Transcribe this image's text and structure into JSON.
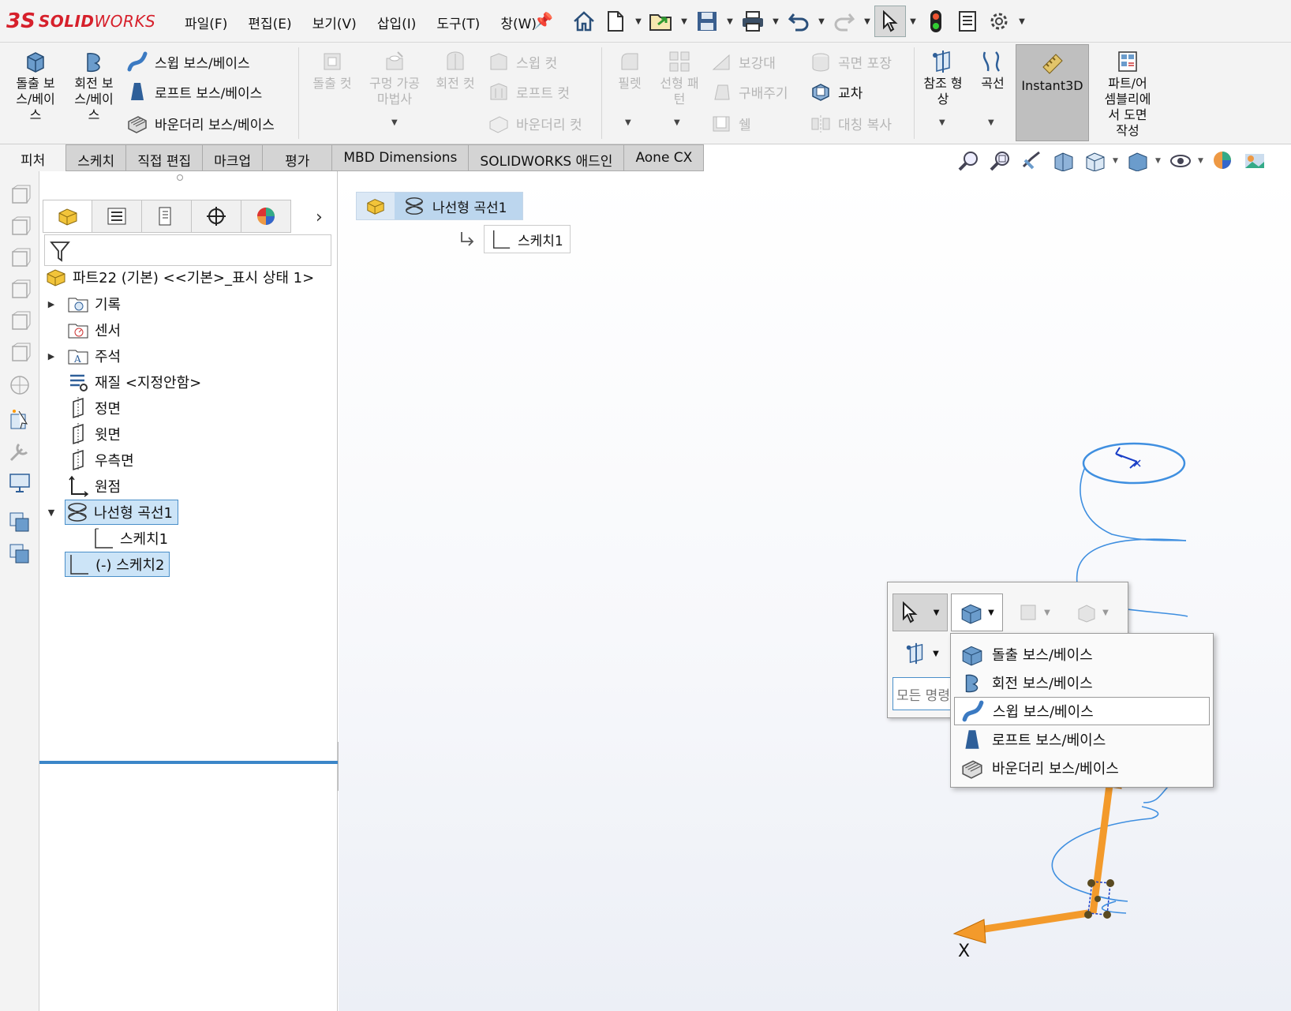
{
  "app": {
    "logo_mark": "3S",
    "logo_solid": "SOLID",
    "logo_works": "WORKS"
  },
  "menu": [
    "파일(F)",
    "편집(E)",
    "보기(V)",
    "삽입(I)",
    "도구(T)",
    "창(W)"
  ],
  "quick_access": [
    "home-icon",
    "new-document-icon",
    "open-icon",
    "save-icon",
    "print-icon",
    "undo-icon",
    "redo-icon",
    "select-icon",
    "rebuild-icon",
    "file-properties-icon",
    "options-icon"
  ],
  "ribbon": {
    "extrude_boss": "돌출 보\n스/베이\n스",
    "revolve_boss": "회전 보\n스/베이\n스",
    "sweep_boss": "스윕 보스/베이스",
    "loft_boss": "로프트 보스/베이스",
    "boundary_boss": "바운더리 보스/베이스",
    "extrude_cut": "돌출 컷",
    "hole_wizard": "구멍 가공\n마법사",
    "revolve_cut": "회전 컷",
    "sweep_cut": "스윕 컷",
    "loft_cut": "로프트 컷",
    "boundary_cut": "바운더리 컷",
    "fillet": "필렛",
    "linear_pattern": "선형 패\n턴",
    "rib": "보강대",
    "draft": "구배주기",
    "shell": "쉘",
    "wrap": "곡면 포장",
    "intersect": "교차",
    "mirror": "대칭 복사",
    "ref_geometry": "참조 형\n상",
    "curves": "곡선",
    "instant3d": "Instant3D",
    "make_drawing": "파트/어\n셈블리에\n서 도면\n작성"
  },
  "tabs": [
    "피처",
    "스케치",
    "직접 편집",
    "마크업",
    "평가",
    "MBD Dimensions",
    "SOLIDWORKS 애드인",
    "Aone CX"
  ],
  "tree": {
    "root": "파트22 (기본) <<기본>_표시 상태 1>",
    "items": [
      {
        "label": "기록",
        "expandable": true
      },
      {
        "label": "센서",
        "expandable": false
      },
      {
        "label": "주석",
        "expandable": true
      },
      {
        "label": "재질 <지정안함>",
        "expandable": false
      },
      {
        "label": "정면",
        "expandable": false
      },
      {
        "label": "윗면",
        "expandable": false
      },
      {
        "label": "우측면",
        "expandable": false
      },
      {
        "label": "원점",
        "expandable": false
      },
      {
        "label": "나선형 곡선1",
        "expandable": true,
        "expanded": true,
        "selected": true
      },
      {
        "label": "스케치1",
        "child": true
      },
      {
        "label": "(-) 스케치2",
        "selected": true
      }
    ]
  },
  "breadcrumb": {
    "feature": "나선형 곡선1",
    "sketch": "스케치1"
  },
  "context_toolbar": {
    "search_placeholder": "모든 명령",
    "menu_items": [
      "돌출 보스/베이스",
      "회전 보스/베이스",
      "스윕 보스/베이스",
      "로프트 보스/베이스",
      "바운더리 보스/베이스"
    ],
    "highlighted_index": 2
  },
  "triad": {
    "x_label": "X"
  },
  "colors": {
    "brand_red": "#d6202b",
    "highlight_blue": "#cce4f7",
    "helix_blue": "#3f8fe0",
    "triad_orange": "#f39a2b"
  }
}
